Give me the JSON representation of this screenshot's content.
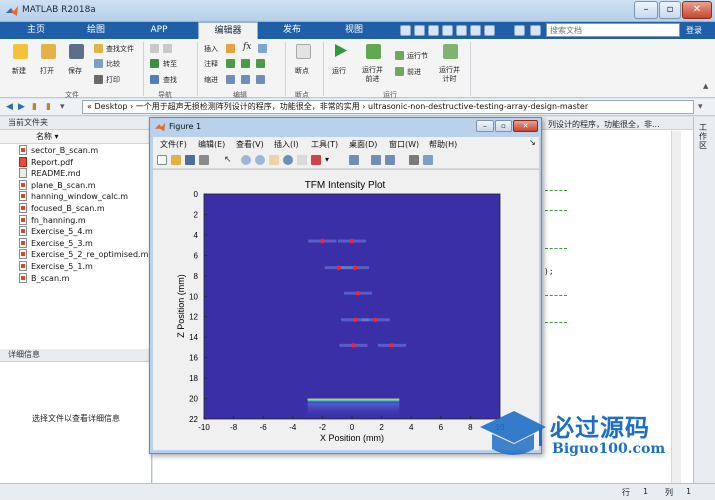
{
  "window": {
    "title": "MATLAB R2018a"
  },
  "tabs": [
    "主页",
    "绘图",
    "APP",
    "编辑器",
    "发布",
    "视图"
  ],
  "search": {
    "placeholder": "搜索文档"
  },
  "login_label": "登录",
  "ribbon": {
    "file": {
      "new": "新建",
      "open": "打开",
      "save": "保存",
      "find_files": "查找文件",
      "compare": "比较",
      "print": "打印",
      "group": "文件"
    },
    "nav": {
      "goto": "转至",
      "find": "查找",
      "group": "导航"
    },
    "edit": {
      "insert": "插入",
      "comment": "注释",
      "indent": "缩进",
      "fx": "fx",
      "group": "编辑"
    },
    "breakpoints": {
      "label": "断点",
      "group": "断点"
    },
    "run": {
      "run": "运行",
      "run_advance": "运行并\n前进",
      "run_section": "运行节",
      "advance": "前进",
      "run_time": "运行并\n计时",
      "group": "运行"
    }
  },
  "address": {
    "path": "« Desktop › 一个用于超声无损检测阵列设计的程序，功能很全，非常的实用 › ultrasonic-non-destructive-testing-array-design-master"
  },
  "left_panel": {
    "title": "当前文件夹",
    "column": "名称",
    "files": [
      {
        "name": "sector_B_scan.m",
        "type": "m"
      },
      {
        "name": "Report.pdf",
        "type": "pdf"
      },
      {
        "name": "README.md",
        "type": "md"
      },
      {
        "name": "plane_B_scan.m",
        "type": "m"
      },
      {
        "name": "hanning_window_calc.m",
        "type": "m"
      },
      {
        "name": "focused_B_scan.m",
        "type": "m"
      },
      {
        "name": "fn_hanning.m",
        "type": "m"
      },
      {
        "name": "Exercise_5_4.m",
        "type": "m"
      },
      {
        "name": "Exercise_5_3.m",
        "type": "m"
      },
      {
        "name": "Exercise_5_2_re_optimised.m",
        "type": "m"
      },
      {
        "name": "Exercise_5_1.m",
        "type": "m"
      },
      {
        "name": "B_scan.m",
        "type": "m"
      }
    ],
    "details_title": "详细信息",
    "details_text": "选择文件以查看详细信息"
  },
  "editor": {
    "header_text": "列设计的程序，功能很全，非...",
    "semicolon": ");"
  },
  "right_strip": {
    "label": "工作区"
  },
  "status": {
    "row_label": "行",
    "row": "1",
    "col_label": "列",
    "col": "1"
  },
  "figure": {
    "title": "Figure 1",
    "menu": [
      "文件(F)",
      "编辑(E)",
      "查看(V)",
      "插入(I)",
      "工具(T)",
      "桌面(D)",
      "窗口(W)",
      "帮助(H)"
    ]
  },
  "chart_data": {
    "type": "heatmap",
    "title": "TFM Intensity Plot",
    "xlabel": "X Position (mm)",
    "ylabel": "Z Position (mm)",
    "xlim": [
      -10,
      10
    ],
    "ylim": [
      0,
      22
    ],
    "y_reversed": true,
    "xticks": [
      -10,
      -8,
      -6,
      -4,
      -2,
      0,
      2,
      4,
      6,
      8,
      10
    ],
    "yticks": [
      0,
      2,
      4,
      6,
      8,
      10,
      12,
      14,
      16,
      18,
      20,
      22
    ],
    "background_color": "#3b2fa8",
    "reflectors": [
      {
        "x": -2.0,
        "z": 4.6
      },
      {
        "x": 0.0,
        "z": 4.6
      },
      {
        "x": -0.9,
        "z": 7.2
      },
      {
        "x": 0.2,
        "z": 7.2
      },
      {
        "x": 0.4,
        "z": 9.7
      },
      {
        "x": 0.2,
        "z": 12.3
      },
      {
        "x": 1.6,
        "z": 12.3
      },
      {
        "x": 0.1,
        "z": 14.8
      },
      {
        "x": 2.7,
        "z": 14.8
      }
    ],
    "backwall": {
      "z": 20.2,
      "x_from": -3.0,
      "x_to": 3.2
    },
    "marker_color": "#ff2222"
  },
  "watermark": {
    "title": "必过源码",
    "url": "Biguo100.com"
  }
}
